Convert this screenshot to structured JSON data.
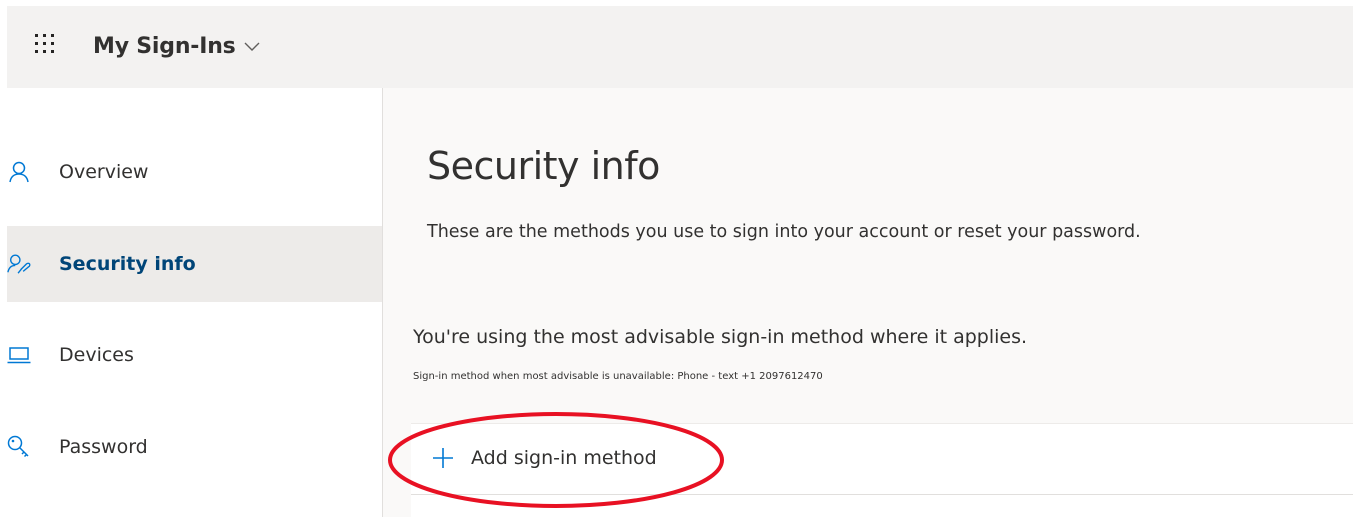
{
  "header": {
    "app_title": "My Sign-Ins",
    "icons": {
      "app_launcher": "waffle-icon",
      "dropdown": "chevron-down-icon"
    }
  },
  "sidebar": {
    "items": [
      {
        "label": "Overview",
        "icon": "person-icon",
        "active": false
      },
      {
        "label": "Security info",
        "icon": "person-key-icon",
        "active": true
      },
      {
        "label": "Devices",
        "icon": "laptop-icon",
        "active": false
      },
      {
        "label": "Password",
        "icon": "key-icon",
        "active": false
      }
    ]
  },
  "main": {
    "title": "Security info",
    "description": "These are the methods you use to sign into your account or reset your password.",
    "advise_text": "You're using the most advisable sign-in method where it applies.",
    "advise_subtext": "Sign-in method when most advisable is unavailable: Phone - text +1 2097612470",
    "add_method_label": "Add sign-in method"
  },
  "colors": {
    "accent": "#0078d4",
    "active_text": "#004578",
    "topbar_bg": "#f3f2f1",
    "main_bg": "#faf9f8",
    "highlight_ring": "#e81123"
  }
}
